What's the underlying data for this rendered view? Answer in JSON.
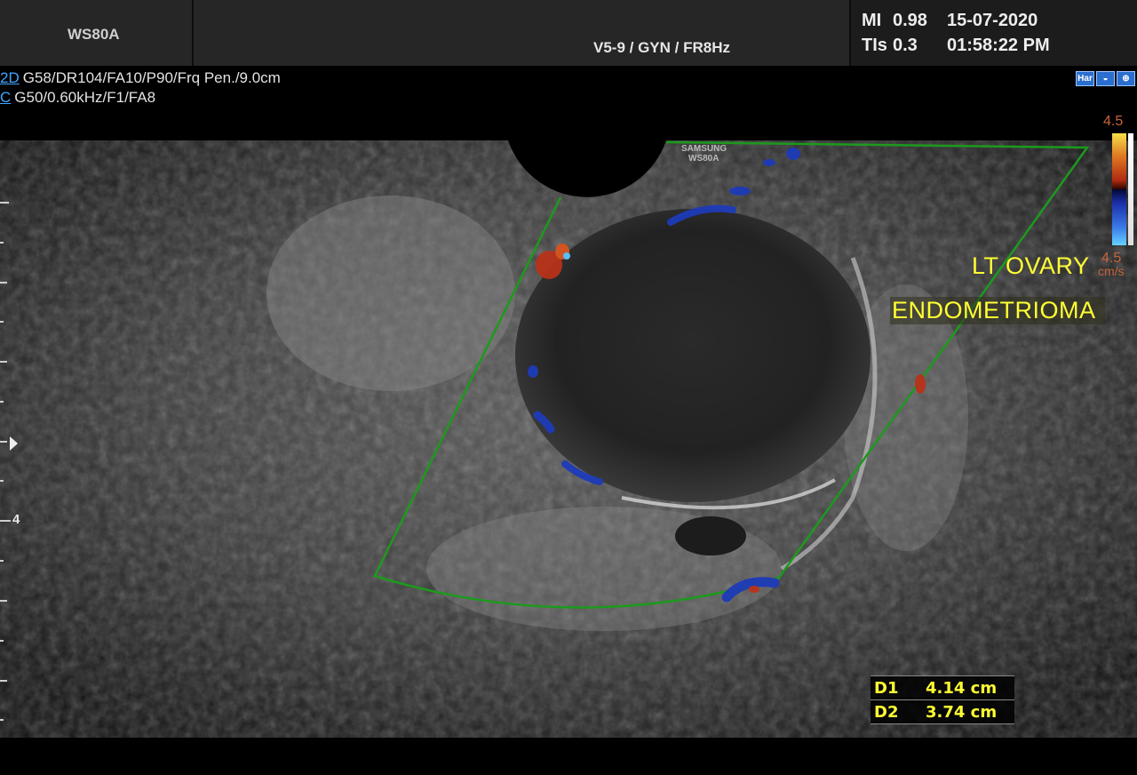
{
  "header": {
    "device": "WS80A",
    "preset": "V5-9 / GYN / FR8Hz",
    "mi_label": "MI",
    "mi_value": "0.98",
    "tis_label": "TIs",
    "tis_value": "0.3",
    "date": "15-07-2020",
    "time": "01:58:22 PM"
  },
  "params": {
    "mode_2d": "2D",
    "line_2d": "G58/DR104/FA10/P90/Frq Pen./9.0cm",
    "mode_c": "C",
    "line_c": "G50/0.60kHz/F1/FA8"
  },
  "mode_icons": [
    "Har",
    "probe-icon",
    "settings-icon"
  ],
  "color_scale": {
    "top": "4.5",
    "bottom": "4.5",
    "unit": "cm/s"
  },
  "probe_label": "SAMSUNG WS80A",
  "depth_marker": "4",
  "annotations": {
    "line1": "LT OVARY",
    "line2": "ENDOMETRIOMA"
  },
  "measurements": [
    {
      "label": "D1",
      "value": "4.14 cm"
    },
    {
      "label": "D2",
      "value": "3.74 cm"
    }
  ],
  "colors": {
    "annotation": "#ffff33",
    "roi_box": "#1c9a1c",
    "mode_link": "#3fa7ff"
  }
}
